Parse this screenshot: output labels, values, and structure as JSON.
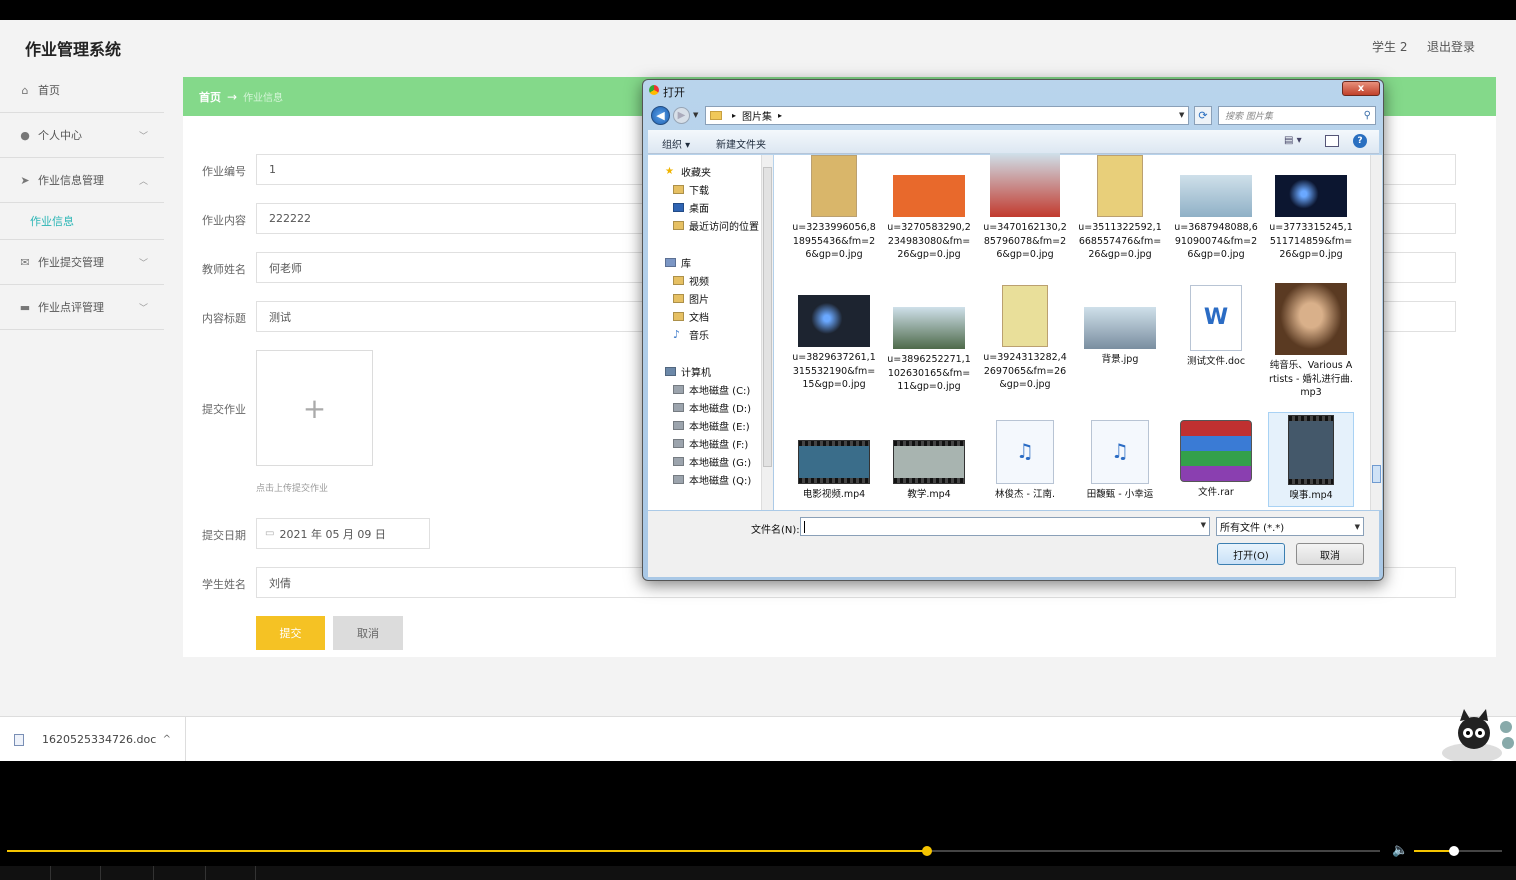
{
  "app": {
    "title": "作业管理系统",
    "user": "学生 2",
    "logout": "退出登录"
  },
  "sidebar": {
    "items": [
      {
        "label": "首页",
        "icon": "home-icon"
      },
      {
        "label": "个人中心",
        "icon": "user-icon"
      },
      {
        "label": "作业信息管理",
        "icon": "send-icon"
      },
      {
        "label": "作业信息",
        "sub": true
      },
      {
        "label": "作业提交管理",
        "icon": "mail-icon"
      },
      {
        "label": "作业点评管理",
        "icon": "monitor-icon"
      }
    ]
  },
  "breadcrumb": {
    "home": "首页",
    "arrow": "→",
    "current": "作业信息"
  },
  "form": {
    "homework_no": {
      "label": "作业编号",
      "value": "1"
    },
    "content": {
      "label": "作业内容",
      "value": "222222"
    },
    "teacher": {
      "label": "教师姓名",
      "value": "何老师"
    },
    "title": {
      "label": "内容标题",
      "value": "测试"
    },
    "upload": {
      "label": "提交作业",
      "plus": "+",
      "hint": "点击上传提交作业"
    },
    "date": {
      "label": "提交日期",
      "value": "2021 年 05 月 09 日"
    },
    "student": {
      "label": "学生姓名",
      "value": "刘倩"
    },
    "submit": "提交",
    "cancel": "取消"
  },
  "downloads": {
    "file": "1620525334726.doc",
    "chevron": "^"
  },
  "dialog": {
    "title": "打开",
    "close": "x",
    "address": {
      "root_sep": "▸",
      "folder": "图片集",
      "tail_sep": "▸"
    },
    "search_placeholder": "搜索 图片集",
    "toolbar": {
      "organize": "组织 ▾",
      "new_folder": "新建文件夹",
      "view": "▤ ▾",
      "help": "?"
    },
    "nav": [
      {
        "label": "收藏夹",
        "type": "star"
      },
      {
        "label": "下载",
        "type": "folder"
      },
      {
        "label": "桌面",
        "type": "desk"
      },
      {
        "label": "最近访问的位置",
        "type": "folder"
      },
      {
        "label": "库",
        "type": "lib"
      },
      {
        "label": "视频",
        "type": "folder"
      },
      {
        "label": "图片",
        "type": "folder"
      },
      {
        "label": "文档",
        "type": "folder"
      },
      {
        "label": "音乐",
        "type": "music"
      },
      {
        "label": "计算机",
        "type": "pc"
      },
      {
        "label": "本地磁盘 (C:)",
        "type": "drive"
      },
      {
        "label": "本地磁盘 (D:)",
        "type": "drive"
      },
      {
        "label": "本地磁盘 (E:)",
        "type": "drive"
      },
      {
        "label": "本地磁盘 (F:)",
        "type": "drive"
      },
      {
        "label": "本地磁盘 (G:)",
        "type": "drive"
      },
      {
        "label": "本地磁盘 (Q:)",
        "type": "drive"
      }
    ],
    "files": [
      {
        "name": "u=3233996056,818955436&fm=26&gp=0.jpg",
        "kind": "jpg-book",
        "color": "#d9b66a"
      },
      {
        "name": "u=3270583290,2234983080&fm=26&gp=0.jpg",
        "kind": "jpg-banner",
        "color": "#e8692c"
      },
      {
        "name": "u=3470162130,285796078&fm=26&gp=0.jpg",
        "kind": "jpg-photo",
        "color": "#c23a2e"
      },
      {
        "name": "u=3511322592,1668557476&fm=26&gp=0.jpg",
        "kind": "jpg-book",
        "color": "#e8cf7a"
      },
      {
        "name": "u=3687948088,691090074&fm=26&gp=0.jpg",
        "kind": "jpg-photo",
        "color": "#8fb0c6"
      },
      {
        "name": "u=3773315245,1511714859&fm=26&gp=0.jpg",
        "kind": "jpg-dark",
        "color": "#0c1630"
      },
      {
        "name": "u=3829637261,1315532190&fm=15&gp=0.jpg",
        "kind": "jpg-dark",
        "color": "#1d2430"
      },
      {
        "name": "u=3896252271,1102630165&fm=11&gp=0.jpg",
        "kind": "jpg-photo",
        "color": "#4e6a4a"
      },
      {
        "name": "u=3924313282,42697065&fm=26&gp=0.jpg",
        "kind": "jpg-book",
        "color": "#e9df9a"
      },
      {
        "name": "背景.jpg",
        "kind": "jpg-photo",
        "color": "#7a8ea0"
      },
      {
        "name": "测试文件.doc",
        "kind": "doc",
        "color": "#2b6cc4"
      },
      {
        "name": "纯音乐、Various Artists - 婚礼进行曲.mp3",
        "kind": "jpg-portrait",
        "color": "#5a3a22"
      },
      {
        "name": "电影视频.mp4",
        "kind": "video",
        "color": "#3a6d8a"
      },
      {
        "name": "教学.mp4",
        "kind": "video",
        "color": "#a8b4b0"
      },
      {
        "name": "林俊杰 - 江南.",
        "kind": "mp3",
        "color": "#2b6cc4"
      },
      {
        "name": "田馥甄 - 小幸运",
        "kind": "mp3",
        "color": "#2b6cc4"
      },
      {
        "name": "文件.rar",
        "kind": "rar",
        "color": "#c03030"
      },
      {
        "name": "嗅事.mp4",
        "kind": "video-portrait",
        "color": "#44586a"
      }
    ],
    "filename_label": "文件名(N):",
    "filename_value": "",
    "filetype": "所有文件 (*.*)",
    "open": "打开(O)",
    "cancel": "取消"
  },
  "player": {
    "progress": 0.67,
    "volume": 0.45
  },
  "colors": {
    "accent_green": "#84d98a",
    "submit_yellow": "#f5c224",
    "sub_teal": "#2ab5b5",
    "player_yellow": "#f5c400"
  }
}
